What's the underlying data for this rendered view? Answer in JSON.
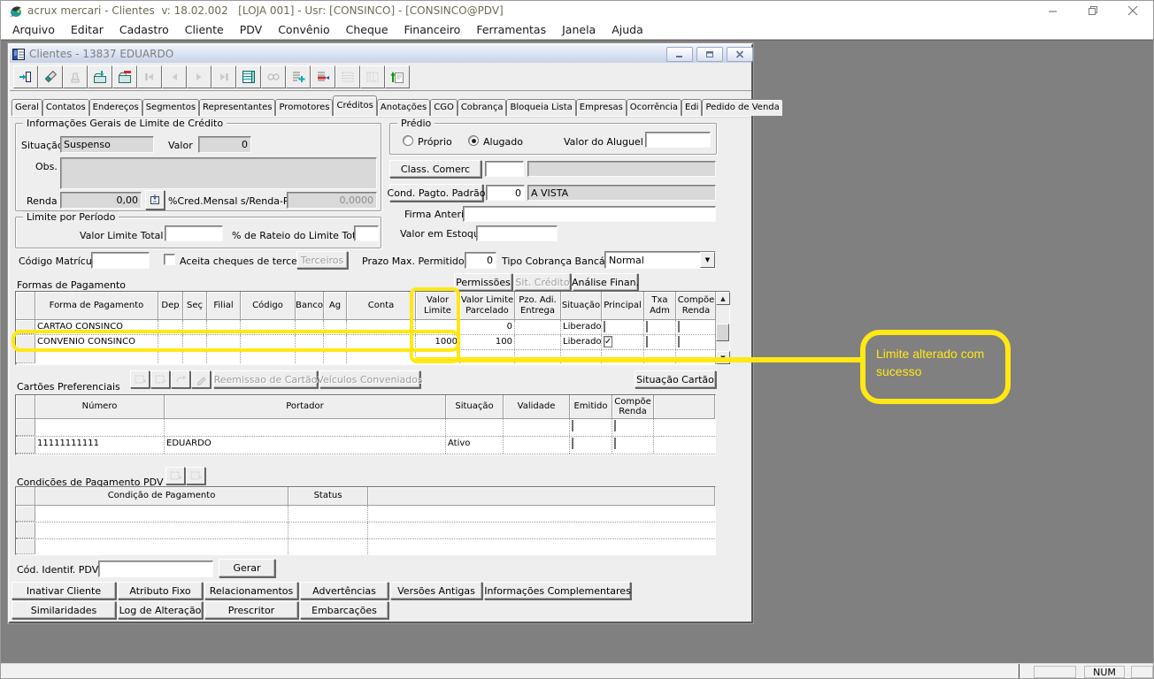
{
  "app": {
    "title": "acrux mercari - Clientes  v: 18.02.002   [LOJA 001] - Usr: [CONSINCO] - [CONSINCO@PDV]",
    "menu": [
      "Arquivo",
      "Editar",
      "Cadastro",
      "Cliente",
      "PDV",
      "Convênio",
      "Cheque",
      "Financeiro",
      "Ferramentas",
      "Janela",
      "Ajuda"
    ],
    "statusbar": {
      "num": "NUM"
    }
  },
  "win": {
    "title": "Clientes - 13837 EDUARDO",
    "toolbar_icons": [
      "exit-icon",
      "erase-icon",
      "stamp-icon",
      "save-import-icon",
      "folder-remove-icon",
      "nav-first-icon",
      "nav-prev-icon",
      "nav-next-icon",
      "nav-last-icon",
      "data-grid-icon",
      "search-icon",
      "insert-record-icon",
      "delete-record-icon",
      "grid-prev-icon",
      "grid-next-icon",
      "export-icon"
    ]
  },
  "tabs": [
    "Geral",
    "Contatos",
    "Endereços",
    "Segmentos",
    "Representantes",
    "Promotores",
    "Créditos",
    "Anotações",
    "CGO",
    "Cobrança",
    "Bloqueia Lista",
    "Empresas",
    "Ocorrência",
    "Edi",
    "Pedido de Venda"
  ],
  "info": {
    "legend": "Informações Gerais de Limite de Crédito",
    "situacao_label": "Situação",
    "situacao": "Suspenso",
    "valor_label": "Valor",
    "valor": "0",
    "obs_label": "Obs.",
    "obs": "",
    "renda_label": "Renda",
    "renda": "0,00",
    "pct_label": "%Cred.Mensal s/Renda-PF",
    "pct": "0,0000"
  },
  "predio": {
    "legend": "Prédio",
    "proprio": "Próprio",
    "alugado": "Alugado",
    "selected": "Alugado",
    "aluguel_label": "Valor do Aluguel",
    "aluguel": ""
  },
  "class_comerc": {
    "button": "Class. Comerc",
    "code": "",
    "desc": ""
  },
  "cond_pagto": {
    "button": "Cond. Pagto. Padrão",
    "code": "0",
    "desc": "A VISTA"
  },
  "firma": {
    "label": "Firma Anterior",
    "value": ""
  },
  "estoque": {
    "label": "Valor em Estoque",
    "value": ""
  },
  "limite_periodo": {
    "legend": "Limite por Período",
    "total_label": "Valor Limite Total",
    "total": "",
    "rateio_label": "% de Rateio do Limite Total",
    "rateio": ""
  },
  "matricula": {
    "label": "Código Matrícula",
    "value": "",
    "cheques_label": "Aceita cheques de terceiros",
    "cheques_checked": "",
    "terceiros": "Terceiros"
  },
  "prazo": {
    "label": "Prazo Max. Permitido",
    "value": "0",
    "tipo_label": "Tipo Cobrança Bancária",
    "tipo": "Normal"
  },
  "credito_botoes": {
    "permissoes": "Permissões",
    "sit_credito": "Sit. Crédito",
    "analise": "Análise Finan."
  },
  "formas": {
    "title": "Formas de Pagamento",
    "headers": [
      "Forma de Pagamento",
      "Dep",
      "Seç",
      "Filial",
      "Código",
      "Banco",
      "Ag",
      "Conta",
      "Valor\nLimite",
      "Valor Limite\nParcelado",
      "Pzo. Adi.\nEntrega",
      "Situação",
      "Principal",
      "Txa\nAdm",
      "Compõe\nRenda"
    ],
    "rows": [
      {
        "forma": "CARTAO CONSINCO",
        "dep": "",
        "sec": "",
        "filial": "",
        "codigo": "",
        "banco": "",
        "ag": "",
        "conta": "",
        "valor_limite": "",
        "valor_parcelado": "0",
        "pzo": "",
        "situacao": "Liberado",
        "principal": "",
        "txa": "",
        "compoe": ""
      },
      {
        "forma": "CONVENIO CONSINCO",
        "dep": "",
        "sec": "",
        "filial": "",
        "codigo": "",
        "banco": "",
        "ag": "",
        "conta": "",
        "valor_limite": "1000",
        "valor_parcelado": "100",
        "pzo": "",
        "situacao": "Liberado",
        "principal": "✓",
        "txa": "",
        "compoe": ""
      },
      {
        "forma": "",
        "dep": "",
        "sec": "",
        "filial": "",
        "codigo": "",
        "banco": "",
        "ag": "",
        "conta": "",
        "valor_limite": "",
        "valor_parcelado": "",
        "pzo": "",
        "situacao": "",
        "principal": "",
        "txa": "",
        "compoe": ""
      }
    ]
  },
  "cartoes": {
    "title": "Cartões Preferenciais",
    "reemissao": "Reemissao de Cartão",
    "veiculos": "Veículos Conveniados",
    "situacao_cartao": "Situação Cartão",
    "headers": [
      "Número",
      "Portador",
      "Situação",
      "Validade",
      "Emitido",
      "Compõe\nRenda"
    ],
    "rows": [
      {
        "numero": "",
        "portador": "",
        "situacao": "",
        "validade": "",
        "emitido": "",
        "compoe": ""
      },
      {
        "numero": "11111111111",
        "portador": "EDUARDO",
        "situacao": "Ativo",
        "validade": "",
        "emitido": "",
        "compoe": ""
      }
    ]
  },
  "condicoes": {
    "title": "Condições de Pagamento PDV",
    "headers": [
      "Condição de Pagamento",
      "Status"
    ]
  },
  "cod_pdv": {
    "label": "Cód. Identif. PDV",
    "value": "",
    "gerar": "Gerar"
  },
  "bottom_buttons": {
    "row1": [
      "Inativar Cliente",
      "Atributo Fixo",
      "Relacionamentos",
      "Advertências",
      "Versões Antigas",
      "Informações Complementares"
    ],
    "row2": [
      "Similaridades",
      "Log de Alteração",
      "Prescritor",
      "Embarcações"
    ]
  },
  "annotation": {
    "text": "Limite alterado com sucesso",
    "color": "#FFE814"
  }
}
